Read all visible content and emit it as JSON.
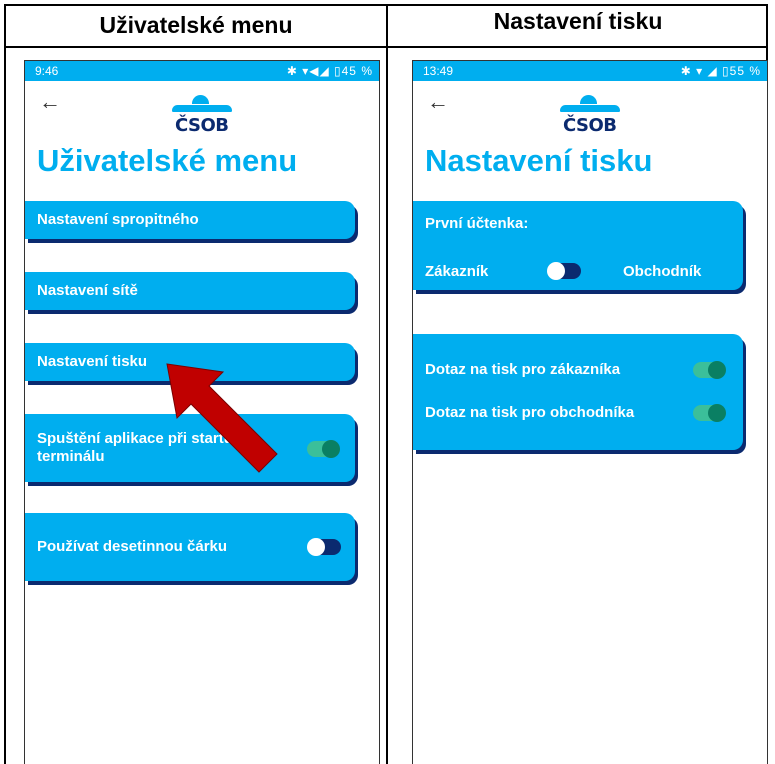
{
  "left_panel": {
    "title": "Uživatelské menu",
    "status": {
      "time": "9:46",
      "icons": "✱ ▾◀◢ ▯45 %"
    },
    "heading": "Uživatelské menu",
    "items": [
      {
        "label": "Nastavení spropitného"
      },
      {
        "label": "Nastavení sítě"
      },
      {
        "label": "Nastavení tisku"
      },
      {
        "label": "Spuštění aplikace při startu terminálu",
        "label_line1": "Spuštění aplikace při startu",
        "label_line2": "terminálu",
        "toggle": "on"
      },
      {
        "label": "Používat desetinnou čárku",
        "toggle": "off"
      }
    ]
  },
  "right_panel": {
    "title": "Nastavení tisku",
    "status": {
      "time": "13:49",
      "icons": "✱ ▾ ◢ ▯55 %"
    },
    "heading": "Nastavení tisku",
    "receipt": {
      "title": "První účtenka:",
      "left_label": "Zákazník",
      "right_label": "Obchodník",
      "toggle": "off"
    },
    "print_queries": [
      {
        "label": "Dotaz na tisk pro zákazníka",
        "toggle": "on"
      },
      {
        "label": "Dotaz na tisk pro obchodníka",
        "toggle": "on"
      }
    ]
  },
  "logo_text": "ČSOB",
  "colors": {
    "accent": "#00aeef",
    "navy": "#0b2a6f",
    "toggle_on": "#3bbf9a",
    "arrow": "#c00000"
  },
  "icons": {
    "back": "arrow-left-icon",
    "annotation": "red-arrow-icon"
  }
}
